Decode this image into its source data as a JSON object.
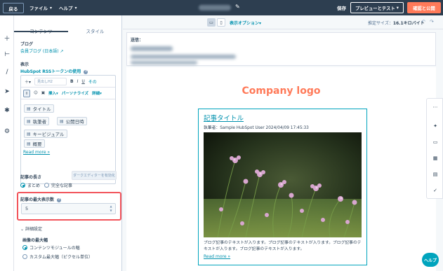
{
  "topbar": {
    "back_label": "戻る",
    "menu_file": "ファイル",
    "menu_help": "ヘルプ",
    "save_label": "保存",
    "preview_label": "プレビューとテスト",
    "publish_label": "確認と公開"
  },
  "panel": {
    "tab_content": "コンテンツ",
    "tab_style": "スタイル",
    "blog_label": "ブログ",
    "blog_link": "会員ブログ (日本語)",
    "display_label": "表示",
    "rss_link": "HubSpot RSSトークンの使用",
    "toolbar": {
      "style_select": "見出しH2",
      "more": "その",
      "insert": "挿入",
      "personalize": "パーソナライズ",
      "advanced": "詳細"
    },
    "tokens": [
      "タイトル",
      "執筆者",
      "公開日時",
      "キービジュアル",
      "概要"
    ],
    "read_more": "Read more »",
    "disable_editor": "ダークエディターを有効化",
    "length_label": "記事の長さ",
    "length_opt_summary": "まとめ",
    "length_opt_full": "完全な記事",
    "max_posts_label": "記事の最大表示数",
    "max_posts_value": "5",
    "advanced_label": "詳細設定",
    "image_width_label": "画像の最大幅",
    "image_opt_module": "コンテンツモジュールの幅",
    "image_opt_custom": "カスタム最大幅（ピクセル単位）"
  },
  "viewbar": {
    "view_options": "表示オプション",
    "est_size_label": "推定サイズ：",
    "est_size_value": "16.1キロバイト"
  },
  "email": {
    "sender_label": "送信：",
    "logo_text": "Company logo",
    "post_title": "記事タイトル",
    "author_line": "執筆者：Sample HubSpot User 2024/04/09 17:45:33",
    "post_body": "ブログ記事のテキストが入ります。ブログ記事のテキストが入ります。ブログ記事のテキストが入ります。ブログ記事のテキストが入ります。",
    "read_more": "Read more »"
  },
  "help_bubble": "ヘルプ",
  "colors": {
    "topbar": "#2d3e50",
    "accent": "#ff7a59",
    "link": "#0091ae",
    "highlight": "#f2545b"
  }
}
